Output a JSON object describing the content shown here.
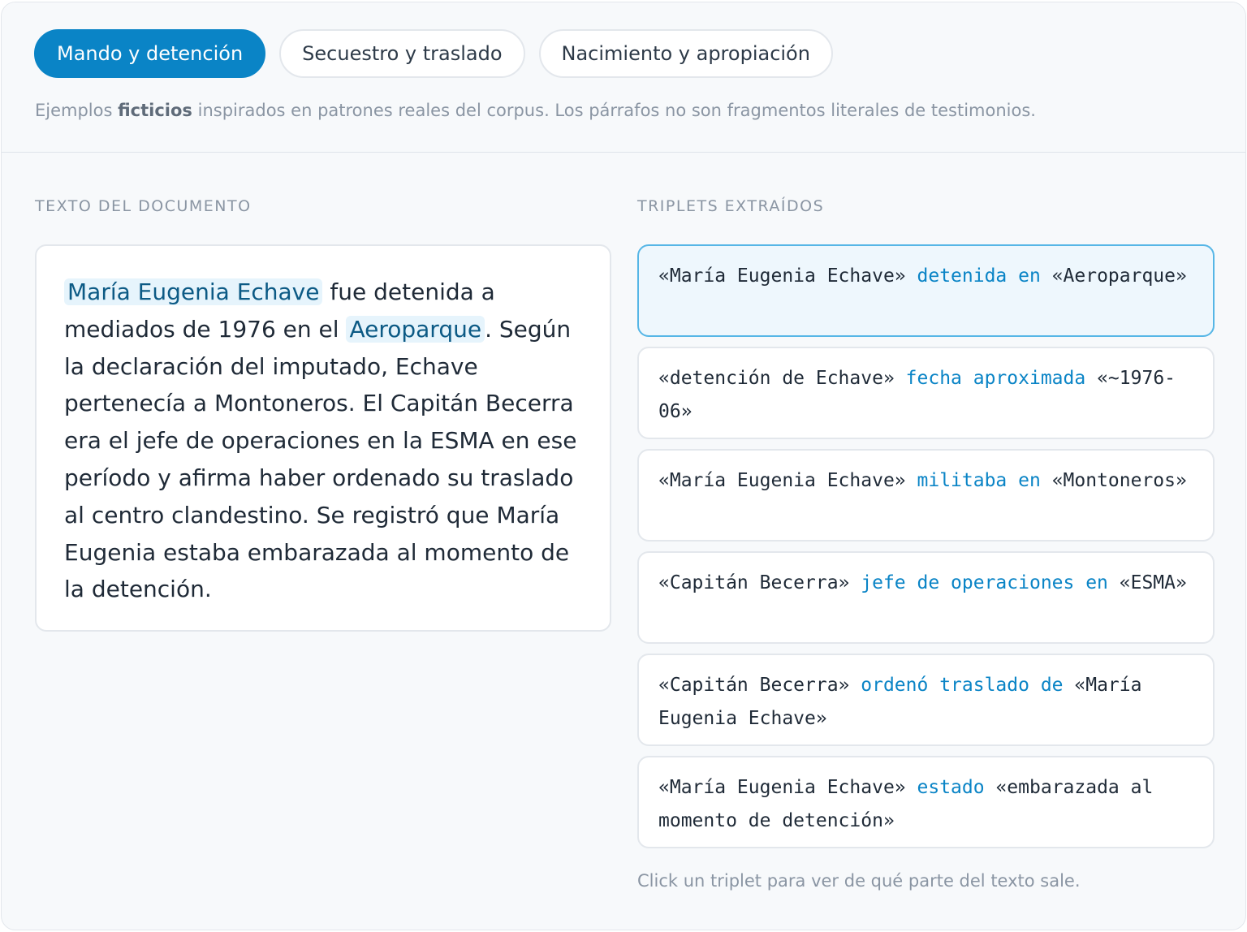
{
  "tabs": [
    {
      "label": "Mando y detención",
      "active": true
    },
    {
      "label": "Secuestro y traslado",
      "active": false
    },
    {
      "label": "Nacimiento y apropiación",
      "active": false
    }
  ],
  "note": {
    "before": "Ejemplos ",
    "bold": "ficticios",
    "after": " inspirados en patrones reales del corpus. Los párrafos no son fragmentos literales de testimonios."
  },
  "document": {
    "label": "TEXTO DEL DOCUMENTO",
    "highlight_1": "María Eugenia Echave",
    "text_1": " fue detenida a mediados de 1976 en el ",
    "highlight_2": "Aeroparque",
    "text_2": ". Según la declaración del imputado, Echave pertenecía a Montoneros. El Capitán Becerra era el jefe de operaciones en la ESMA en ese período y afirma haber ordenado su traslado al centro clandestino. Se registró que María Eugenia estaba embarazada al momento de la detención."
  },
  "triplets_panel": {
    "label": "TRIPLETS EXTRAÍDOS",
    "hint": "Click un triplet para ver de qué parte del texto sale."
  },
  "triplets": [
    {
      "subject": "«María Eugenia Echave»",
      "predicate": "detenida en",
      "object": "«Aeroparque»",
      "active": true
    },
    {
      "subject": "«detención de Echave»",
      "predicate": "fecha aproximada",
      "object": "«~1976-06»",
      "active": false
    },
    {
      "subject": "«María Eugenia Echave»",
      "predicate": "militaba en",
      "object": "«Montoneros»",
      "active": false
    },
    {
      "subject": "«Capitán Becerra»",
      "predicate": "jefe de operaciones en",
      "object": "«ESMA»",
      "active": false
    },
    {
      "subject": "«Capitán Becerra»",
      "predicate": "ordenó traslado de",
      "object": "«María Eugenia Echave»",
      "active": false
    },
    {
      "subject": "«María Eugenia Echave»",
      "predicate": "estado",
      "object": "«embarazada al momento de detención»",
      "active": false
    }
  ],
  "colors": {
    "accent": "#0a84c6",
    "highlight_bg": "#e6f4fc",
    "active_card_bg": "#eef7fd",
    "active_card_border": "#56b6e6"
  }
}
